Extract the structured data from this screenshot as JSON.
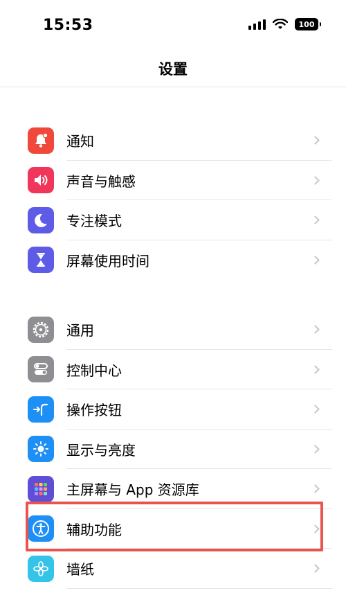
{
  "status_bar": {
    "time": "15:53",
    "battery": "100"
  },
  "nav": {
    "title": "设置"
  },
  "groups": [
    {
      "items": [
        {
          "label": "通知",
          "icon": "bell-icon",
          "color": "#f0493c"
        },
        {
          "label": "声音与触感",
          "icon": "speaker-icon",
          "color": "#f0365a"
        },
        {
          "label": "专注模式",
          "icon": "moon-icon",
          "color": "#5e5ce6"
        },
        {
          "label": "屏幕使用时间",
          "icon": "hourglass-icon",
          "color": "#5e5ce6"
        }
      ]
    },
    {
      "items": [
        {
          "label": "通用",
          "icon": "gear-icon",
          "color": "#8e8e93"
        },
        {
          "label": "控制中心",
          "icon": "toggles-icon",
          "color": "#8e8e93"
        },
        {
          "label": "操作按钮",
          "icon": "action-button-icon",
          "color": "#1e8ff5"
        },
        {
          "label": "显示与亮度",
          "icon": "sun-icon",
          "color": "#1e8ff5"
        },
        {
          "label": "主屏幕与 App 资源库",
          "icon": "app-grid-icon",
          "color": "#5f4fd6"
        },
        {
          "label": "辅助功能",
          "icon": "accessibility-icon",
          "color": "#1e8ff5"
        },
        {
          "label": "墙纸",
          "icon": "flower-icon",
          "color": "#36c3e8"
        }
      ]
    }
  ],
  "highlight": {
    "color": "#e8544e"
  }
}
